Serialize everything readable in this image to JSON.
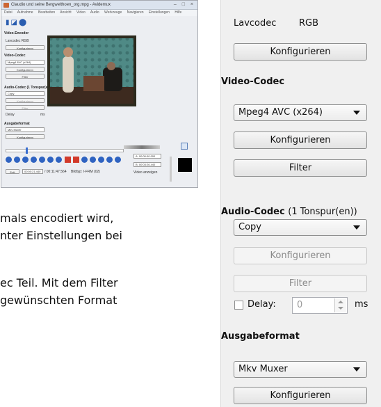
{
  "document": {
    "line1": "mals encodiert wird,",
    "line2": "nter Einstellungen bei",
    "line3": "ec Teil. Mit dem Filter",
    "line4": "gewünschten Format"
  },
  "thumbnail": {
    "title": "Claudio und seine Bergwelthoen_org.mpg - Avidemux",
    "window_buttons": "– □ ×",
    "menu": "Datei Aufnahme Bearbeiten Ansicht Video Audio Werkzeuge Navigieren Einstellungen Hilfe",
    "video_encoder_heading": "Video-Encoder",
    "video_encoder_value": "Lavcodec RGB",
    "video_codec_heading": "Video-Codec",
    "video_codec_value": "Mpeg4 AVC (x264)",
    "audio_codec_heading": "Audio-Codec (1 Tonspur(en))",
    "audio_codec_value": "Copy",
    "delay_label": "Delay",
    "delay_value": "0",
    "delay_unit": "ms",
    "output_heading": "Ausgabeformat",
    "output_value": "Mkv Muxer",
    "configure_label": "Konfigurieren",
    "filter_label": "Filter",
    "time_a": "A: 00:00:00.000",
    "time_b": "B: 00:03:26.440",
    "time_current": "00:00:21.440",
    "time_total": "/ 00:11:47.564",
    "frame_type": "Bildtyp: I-FRM (02)",
    "show_label": "Video anzeigen",
    "status_btn": "Zeit:"
  },
  "panel": {
    "video_encoder": {
      "codec": "Lavcodec",
      "colorspace": "RGB",
      "configure": "Konfigurieren"
    },
    "video_codec": {
      "heading": "Video-Codec",
      "selected": "Mpeg4 AVC (x264)",
      "configure": "Konfigurieren",
      "filter": "Filter"
    },
    "audio_codec": {
      "heading": "Audio-Codec",
      "tracks": "(1 Tonspur(en))",
      "selected": "Copy",
      "configure": "Konfigurieren",
      "filter": "Filter",
      "delay_label": "Delay:",
      "delay_value": "0",
      "delay_unit": "ms"
    },
    "output_format": {
      "heading": "Ausgabeformat",
      "selected": "Mkv Muxer",
      "configure": "Konfigurieren"
    }
  }
}
